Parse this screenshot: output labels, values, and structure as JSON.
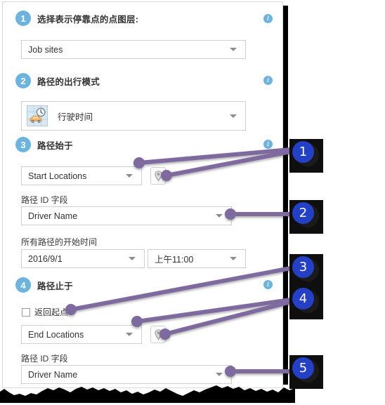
{
  "panel": {
    "steps": [
      {
        "number": "1",
        "title": "选择表示停靠点的点图层:",
        "info_icon": "info-icon"
      },
      {
        "number": "2",
        "title": "路径的出行模式",
        "info_icon": "info-icon"
      },
      {
        "number": "3",
        "title": "路径始于",
        "info_icon": "info-icon"
      },
      {
        "number": "4",
        "title": "路径止于",
        "info_icon": "info-icon"
      }
    ],
    "stop_layer_select": {
      "value": "Job sites",
      "caret": "chevron-down-icon"
    },
    "travel_mode_select": {
      "value": "行驶时间",
      "icon": "car-clock-icon",
      "caret": "chevron-down-icon"
    },
    "start_locations_select": {
      "value": "Start Locations",
      "caret": "chevron-down-icon"
    },
    "start_pin_button": {
      "icon": "map-pin-icon"
    },
    "start_route_id_label": "路径 ID 字段",
    "start_route_id_select": {
      "value": "Driver Name",
      "caret": "chevron-down-icon"
    },
    "start_time_label": "所有路径的开始时间",
    "start_date_select": {
      "value": "2016/9/1",
      "caret": "chevron-down-icon"
    },
    "start_time_select": {
      "value": "上午11:00",
      "caret": "chevron-down-icon"
    },
    "return_to_start_checkbox": {
      "label": "返回起点",
      "checked": false
    },
    "end_locations_select": {
      "value": "End Locations",
      "caret": "chevron-down-icon"
    },
    "end_pin_button": {
      "icon": "map-pin-icon"
    },
    "end_route_id_label": "路径 ID 字段",
    "end_route_id_select": {
      "value": "Driver Name",
      "caret": "chevron-down-icon"
    }
  },
  "callouts": [
    {
      "number": "1"
    },
    {
      "number": "2"
    },
    {
      "number": "3"
    },
    {
      "number": "4"
    },
    {
      "number": "5"
    }
  ],
  "colors": {
    "step_accent": "#6cb4dd",
    "callout_blue": "#2440c4",
    "leader_line": "#7e6a9e",
    "panel_border": "#d9d9d9",
    "field_border": "#cfcfcf"
  }
}
